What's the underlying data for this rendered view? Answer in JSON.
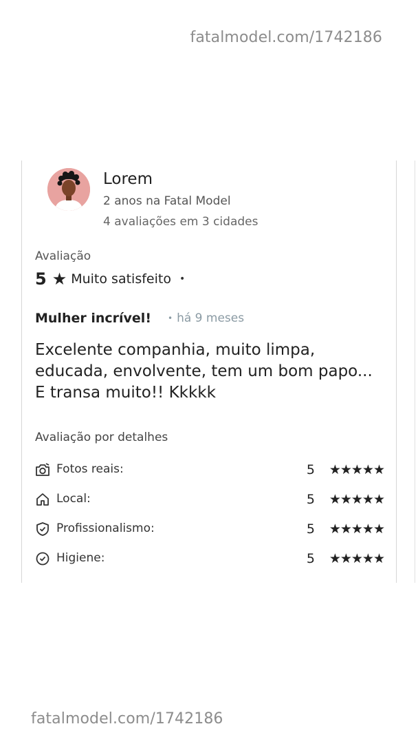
{
  "watermark": {
    "top": "fatalmodel.com/1742186",
    "bottom": "fatalmodel.com/1742186"
  },
  "reviewer": {
    "name": "Lorem",
    "tenure": "2 anos na Fatal Model",
    "reviews_summary": "4 avaliações em 3 cidades",
    "avatar": "person-avatar-icon"
  },
  "rating": {
    "label": "Avaliação",
    "score": "5",
    "star": "★",
    "text": "Muito satisfeito",
    "dot": "•"
  },
  "review": {
    "title": "Mulher incrível!",
    "time_dot": "•",
    "time": "há 9 meses",
    "body": "Excelente companhia, muito limpa, educada, envolvente, tem um bom papo... E transa muito!! Kkkkk"
  },
  "details": {
    "title": "Avaliação por detalhes",
    "items": [
      {
        "icon": "camera-icon",
        "label": "Fotos reais:",
        "score": "5",
        "stars": "★★★★★"
      },
      {
        "icon": "home-icon",
        "label": "Local:",
        "score": "5",
        "stars": "★★★★★"
      },
      {
        "icon": "shield-check-icon",
        "label": "Profissionalismo:",
        "score": "5",
        "stars": "★★★★★"
      },
      {
        "icon": "check-circle-icon",
        "label": "Higiene:",
        "score": "5",
        "stars": "★★★★★"
      }
    ]
  },
  "colors": {
    "text": "#222222",
    "muted": "#8a9aa3",
    "avatar_bg": "#e8a3a0",
    "watermark": "#8c8c8c"
  }
}
